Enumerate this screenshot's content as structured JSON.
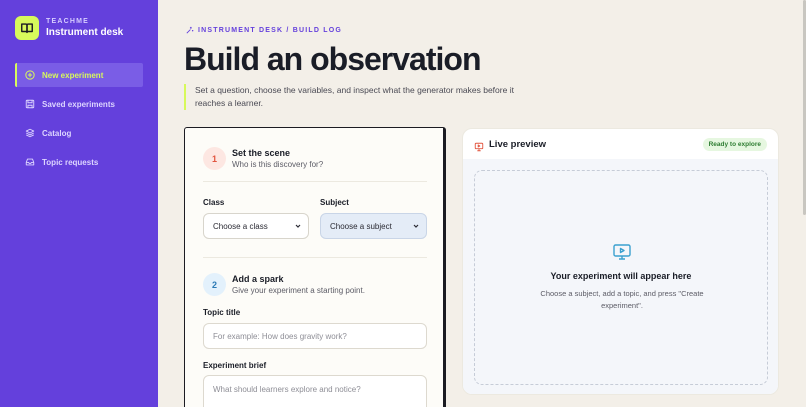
{
  "sidebar": {
    "brand_kicker": "TEACHME",
    "brand_name": "Instrument desk",
    "items": [
      {
        "label": "New experiment",
        "icon": "plus-circle-icon",
        "active": true
      },
      {
        "label": "Saved experiments",
        "icon": "save-icon"
      },
      {
        "label": "Catalog",
        "icon": "layers-icon"
      },
      {
        "label": "Topic requests",
        "icon": "inbox-icon"
      }
    ]
  },
  "header": {
    "eyebrow": "INSTRUMENT DESK / BUILD LOG",
    "title": "Build an observation",
    "intro": "Set a question, choose the variables, and inspect what the generator makes before it reaches a learner."
  },
  "form": {
    "step1": {
      "number": "1",
      "title": "Set the scene",
      "subtitle": "Who is this discovery for?"
    },
    "class_label": "Class",
    "class_value": "Choose a class",
    "subject_label": "Subject",
    "subject_value": "Choose a subject",
    "step2": {
      "number": "2",
      "title": "Add a spark",
      "subtitle": "Give your experiment a starting point."
    },
    "topic_label": "Topic title",
    "topic_placeholder": "For example: How does gravity work?",
    "brief_label": "Experiment brief",
    "brief_placeholder": "What should learners explore and notice?"
  },
  "preview": {
    "title": "Live preview",
    "status": "Ready to explore",
    "empty_title": "Your experiment will appear here",
    "empty_sub": "Choose a subject, add a topic, and press \"Create experiment\"."
  },
  "colors": {
    "sidebar": "#6440dc",
    "accent": "#d7f95b",
    "background": "#f3efe8"
  }
}
